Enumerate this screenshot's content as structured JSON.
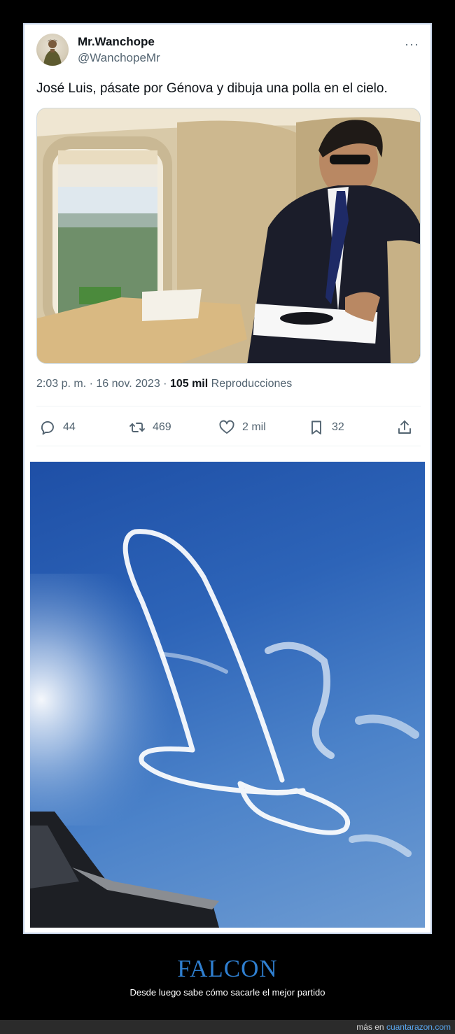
{
  "tweet": {
    "display_name": "Mr.Wanchope",
    "handle": "@WanchopeMr",
    "text": "José Luis, pásate por Génova y dibuja una polla en el cielo.",
    "time": "2:03 p. m.",
    "separator": " · ",
    "date": "16 nov. 2023",
    "views_count": "105 mil",
    "views_label": "Reproducciones",
    "more_icon": "···",
    "actions": {
      "replies": "44",
      "retweets": "469",
      "likes": "2 mil",
      "bookmarks": "32"
    }
  },
  "caption": {
    "title": "FALCON",
    "subtitle": "Desde luego sabe cómo sacarle el mejor partido"
  },
  "footer": {
    "prefix": "más en",
    "site": "cuantarazon.com"
  },
  "colors": {
    "accent_title": "#2f7fd0",
    "link": "#5aa8f0",
    "frame_border": "#c7d4e8",
    "secondary_text": "#536471"
  },
  "icons": [
    "more-icon",
    "reply-icon",
    "retweet-icon",
    "like-icon",
    "bookmark-icon",
    "share-icon"
  ]
}
